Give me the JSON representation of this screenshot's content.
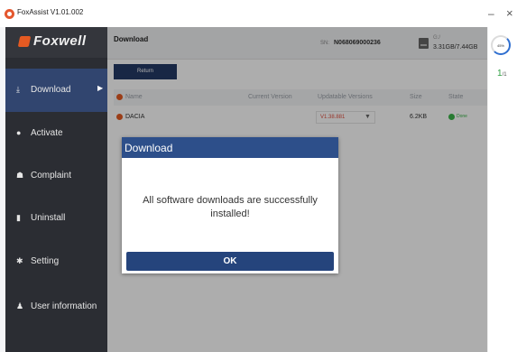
{
  "window": {
    "title": "FoxAssist  V1.01.002",
    "minimize_glyph": "–",
    "close_glyph": "×"
  },
  "sidebar": {
    "logo_text": "Foxwell",
    "items": [
      {
        "label": "Download",
        "icon": "download-icon",
        "icon_glyph": "⤓",
        "active": true,
        "arrow": "▶"
      },
      {
        "label": "Activate",
        "icon": "activate-icon",
        "icon_glyph": "●"
      },
      {
        "label": "Complaint",
        "icon": "complaint-icon",
        "icon_glyph": "☗"
      },
      {
        "label": "Uninstall",
        "icon": "trash-icon",
        "icon_glyph": "▮"
      },
      {
        "label": "Setting",
        "icon": "gear-icon",
        "icon_glyph": "✱"
      },
      {
        "label": "User information",
        "icon": "user-icon",
        "icon_glyph": "♟"
      }
    ]
  },
  "header": {
    "page_title": "Download",
    "sn_label": "SN:",
    "sn_value": "N068069000236",
    "drive_label": "G:/",
    "storage": "3.31GB/7.44GB"
  },
  "toolbar": {
    "return_label": "Return"
  },
  "table": {
    "columns": [
      "Name",
      "Current Version",
      "Updatable Versions",
      "Size",
      "State"
    ],
    "rows": [
      {
        "name": "DACIA",
        "current_version": "",
        "updatable_version": "V1.38.881",
        "size": "6.2KB",
        "state": "Done"
      }
    ]
  },
  "right_panel": {
    "storage_percent": "45%",
    "page_current": "1",
    "page_total": "/1"
  },
  "dialog": {
    "title": "Download",
    "message": "All software downloads are successfully installed!",
    "ok_label": "OK"
  },
  "colors": {
    "sidebar_bg": "#2b2d33",
    "sidebar_active": "#31456f",
    "accent_blue": "#25447c",
    "brand_orange": "#e45a22",
    "done_green": "#3bb54a"
  }
}
